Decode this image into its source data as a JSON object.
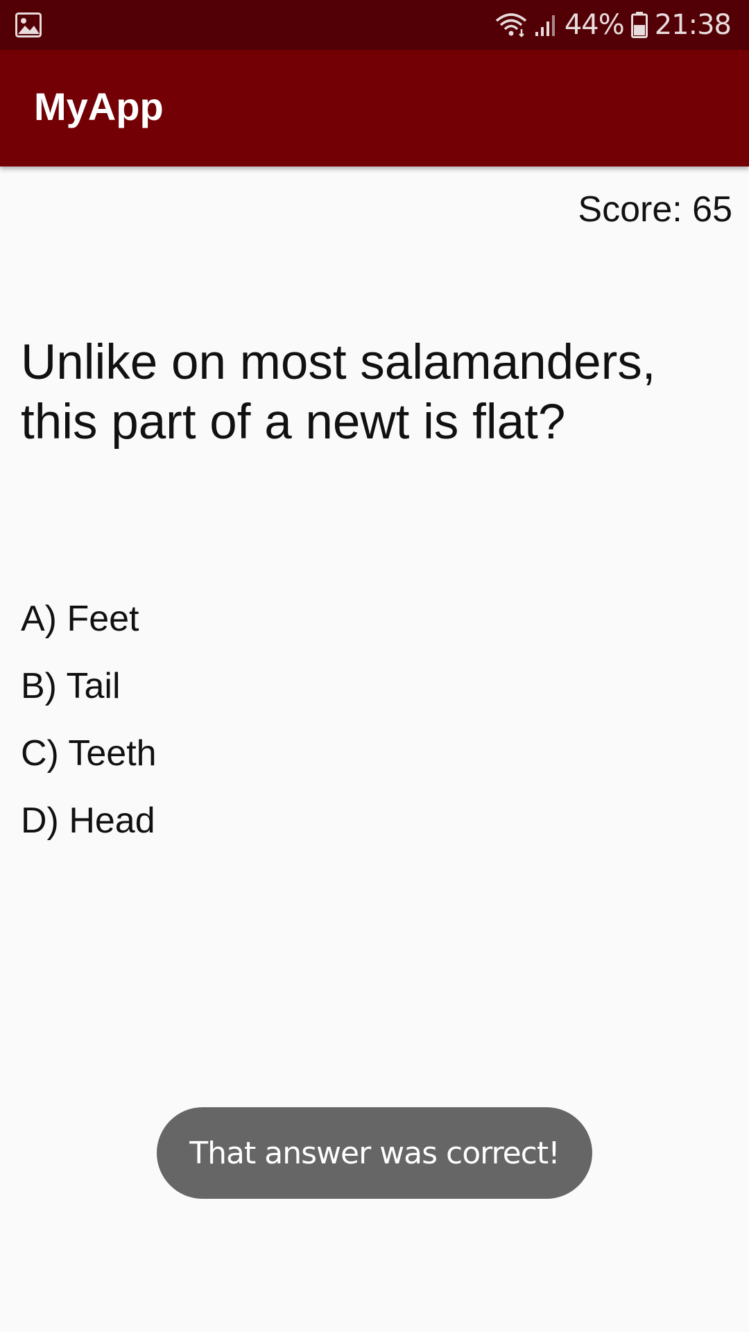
{
  "status_bar": {
    "battery": "44%",
    "time": "21:38",
    "icons": [
      "gallery-notification-icon",
      "wifi-icon",
      "signal-icon",
      "battery-icon"
    ]
  },
  "app_bar": {
    "title": "MyApp",
    "color": "#730005"
  },
  "quiz": {
    "score_label": "Score: 65",
    "question": "Unlike on most salamanders, this part of a newt is flat?",
    "options": [
      {
        "label": "A) Feet"
      },
      {
        "label": "B) Tail"
      },
      {
        "label": "C) Teeth"
      },
      {
        "label": "D) Head"
      }
    ]
  },
  "toast": {
    "message": "That answer was correct!"
  },
  "colors": {
    "status_bar": "#520005",
    "app_bar": "#730005",
    "background": "#fafafa",
    "toast": "#666666"
  }
}
